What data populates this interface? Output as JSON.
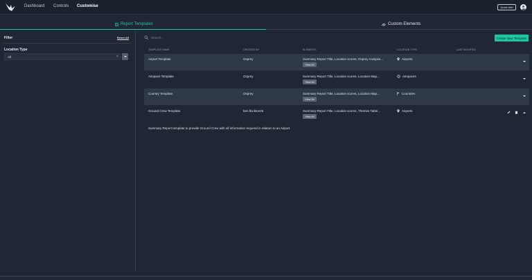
{
  "nav": {
    "items": [
      {
        "label": "Dashboard"
      },
      {
        "label": "Controls"
      },
      {
        "label": "Customise"
      }
    ],
    "quick_add": "Quick Add"
  },
  "tabs": {
    "report": "Report Templates",
    "custom": "Custom Elements"
  },
  "sidebar": {
    "title": "Filter",
    "reset": "Reset All",
    "location_type_label": "Location Type",
    "location_type_value": "All",
    "clear_symbol": "×"
  },
  "search": {
    "placeholder": "Search..."
  },
  "create_button": "Create New Template",
  "table": {
    "headers": {
      "name": "TEMPLATE NAME",
      "created_by": "CREATED BY",
      "elements": "ELEMENTS",
      "location_type": "LOCATION TYPE",
      "last_modified": "LAST MODIFIED"
    },
    "rows": [
      {
        "name": "Airport Template",
        "created_by": "Osprey",
        "elements": "Summary Report Title, Location scores, Osprey Analysis...",
        "location_type": "Airports",
        "view_all": "View All"
      },
      {
        "name": "Airspace Template",
        "created_by": "Osprey",
        "elements": "Summary Report Title, Location scores, Location Map...",
        "location_type": "Airspaces",
        "view_all": "View All"
      },
      {
        "name": "Country Template",
        "created_by": "Osprey",
        "elements": "Summary Report Title, Location scores, Location Map...",
        "location_type": "Countries",
        "view_all": "View All"
      },
      {
        "name": "Ground Crew Template",
        "created_by": "ben.flockton25",
        "elements": "Summary Report Title, Location scores, Themes Table...",
        "location_type": "Airports",
        "view_all": "View All"
      }
    ],
    "expanded_description": "Summary Report template to provide Ground Crew with all information required in relation to an Airport."
  },
  "colors": {
    "accent": "#1fc7a0",
    "background": "#1f2735",
    "row_shaded": "#2e3848"
  },
  "icons": [
    "logo-bird-icon",
    "report-template-icon",
    "custom-elements-icon",
    "search-icon",
    "map-pin-icon",
    "airspace-icon",
    "flag-icon",
    "chevron-down-icon",
    "chevron-up-icon",
    "edit-icon",
    "delete-icon",
    "avatar-icon"
  ]
}
